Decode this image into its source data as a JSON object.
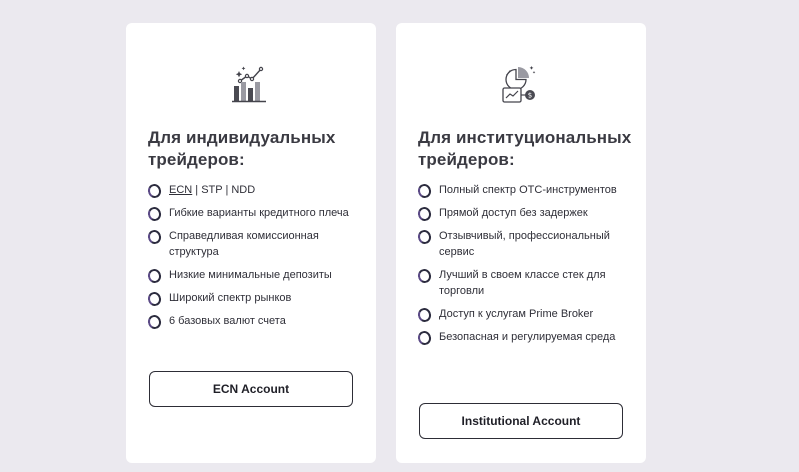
{
  "cards": [
    {
      "icon": "bar-chart-growth-icon",
      "title": "Для индивидуальных трейдеров:",
      "features_first": {
        "ecn": "ECN",
        "rest": " | STP | NDD"
      },
      "features": [
        "Гибкие варианты кредитного плеча",
        "Справедливая комиссионная структура",
        "Низкие минимальные депозиты",
        "Широкий спектр рынков",
        "6 базовых валют счета"
      ],
      "button": "ECN Account"
    },
    {
      "icon": "institutional-analytics-icon",
      "title": "Для институциональных трейдеров:",
      "features": [
        "Полный спектр OTC-инструментов",
        "Прямой доступ без задержек",
        "Отзывчивый, профессиональный сервис",
        "Лучший в своем классе стек для торговли",
        "Доступ к услугам Prime Broker",
        "Безопасная и регулируемая среда"
      ],
      "button": "Institutional Account"
    }
  ],
  "colors": {
    "background": "#ebe9ef",
    "card": "#ffffff",
    "text": "#2b2b33",
    "border": "#2d2d36"
  }
}
